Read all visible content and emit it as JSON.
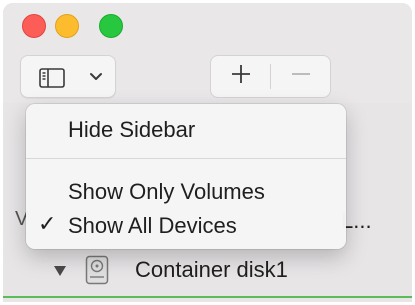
{
  "toolbar": {
    "sidebar_button_icon": "sidebar-icon",
    "dropdown_icon": "chevron-down-icon",
    "add_symbol": "+",
    "remove_symbol": "—"
  },
  "menu": {
    "items": [
      {
        "label": "Hide Sidebar",
        "checked": false
      },
      {
        "label": "Show Only Volumes",
        "checked": false
      },
      {
        "label": "Show All Devices",
        "checked": true
      }
    ],
    "check_symbol": "✓"
  },
  "sidebar": {
    "partial_left_text": "V",
    "truncated_text": "L...",
    "container_label": "Container disk1"
  },
  "colors": {
    "close": "#fd5d57",
    "minimize": "#fdbc2e",
    "zoom": "#27c840",
    "selection_underline": "#5bbd5a"
  }
}
